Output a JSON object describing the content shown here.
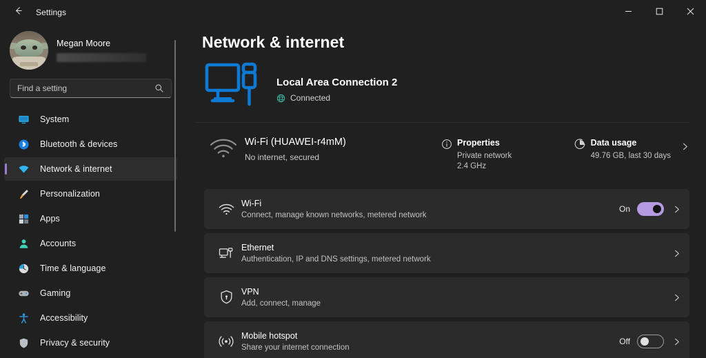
{
  "window": {
    "title": "Settings",
    "back_icon": "back-arrow-icon",
    "controls": {
      "minimize": "minimize-icon",
      "maximize": "maximize-icon",
      "close": "close-icon"
    }
  },
  "sidebar": {
    "profile": {
      "name": "Megan Moore",
      "email_redacted": true
    },
    "search": {
      "placeholder": "Find a setting",
      "icon": "search-icon"
    },
    "selected": "Network & internet",
    "accent": "#9a7bd4",
    "items": [
      {
        "label": "System",
        "icon": "monitor-icon",
        "selected": false
      },
      {
        "label": "Bluetooth & devices",
        "icon": "bluetooth-icon",
        "selected": false
      },
      {
        "label": "Network & internet",
        "icon": "wifi-icon",
        "selected": true
      },
      {
        "label": "Personalization",
        "icon": "paintbrush-icon",
        "selected": false
      },
      {
        "label": "Apps",
        "icon": "apps-grid-icon",
        "selected": false
      },
      {
        "label": "Accounts",
        "icon": "person-icon",
        "selected": false
      },
      {
        "label": "Time & language",
        "icon": "clock-icon",
        "selected": false
      },
      {
        "label": "Gaming",
        "icon": "gamepad-icon",
        "selected": false
      },
      {
        "label": "Accessibility",
        "icon": "accessibility-icon",
        "selected": false
      },
      {
        "label": "Privacy & security",
        "icon": "shield-icon",
        "selected": false
      }
    ]
  },
  "main": {
    "page_title": "Network & internet",
    "hero": {
      "illustration": "pc-ethernet-icon",
      "name": "Local Area Connection 2",
      "status": "Connected",
      "status_icon": "globe-icon",
      "illustration_color": "#0f7ad4"
    },
    "status_strip": {
      "wifi_icon": "wifi-signal-icon",
      "wifi_name": "Wi-Fi (HUAWEI-r4mM)",
      "wifi_status": "No internet, secured",
      "properties": {
        "icon": "info-circle-icon",
        "title": "Properties",
        "line1": "Private network",
        "line2": "2.4 GHz"
      },
      "data_usage": {
        "icon": "pie-chart-icon",
        "title": "Data usage",
        "line1": "49.76 GB, last 30 days"
      },
      "chevron": "chevron-right-icon"
    },
    "cards": [
      {
        "icon": "wifi-signal-icon",
        "title": "Wi-Fi",
        "subtitle": "Connect, manage known networks, metered network",
        "toggle": {
          "present": true,
          "label": "On",
          "state": "on",
          "color": "#b49ae0"
        },
        "chevron": "chevron-right-icon"
      },
      {
        "icon": "ethernet-icon",
        "title": "Ethernet",
        "subtitle": "Authentication, IP and DNS settings, metered network",
        "toggle": {
          "present": false,
          "label": "",
          "state": ""
        },
        "chevron": "chevron-right-icon"
      },
      {
        "icon": "vpn-shield-icon",
        "title": "VPN",
        "subtitle": "Add, connect, manage",
        "toggle": {
          "present": false,
          "label": "",
          "state": ""
        },
        "chevron": "chevron-right-icon"
      },
      {
        "icon": "hotspot-icon",
        "title": "Mobile hotspot",
        "subtitle": "Share your internet connection",
        "toggle": {
          "present": true,
          "label": "Off",
          "state": "off"
        },
        "chevron": "chevron-right-icon"
      }
    ]
  }
}
